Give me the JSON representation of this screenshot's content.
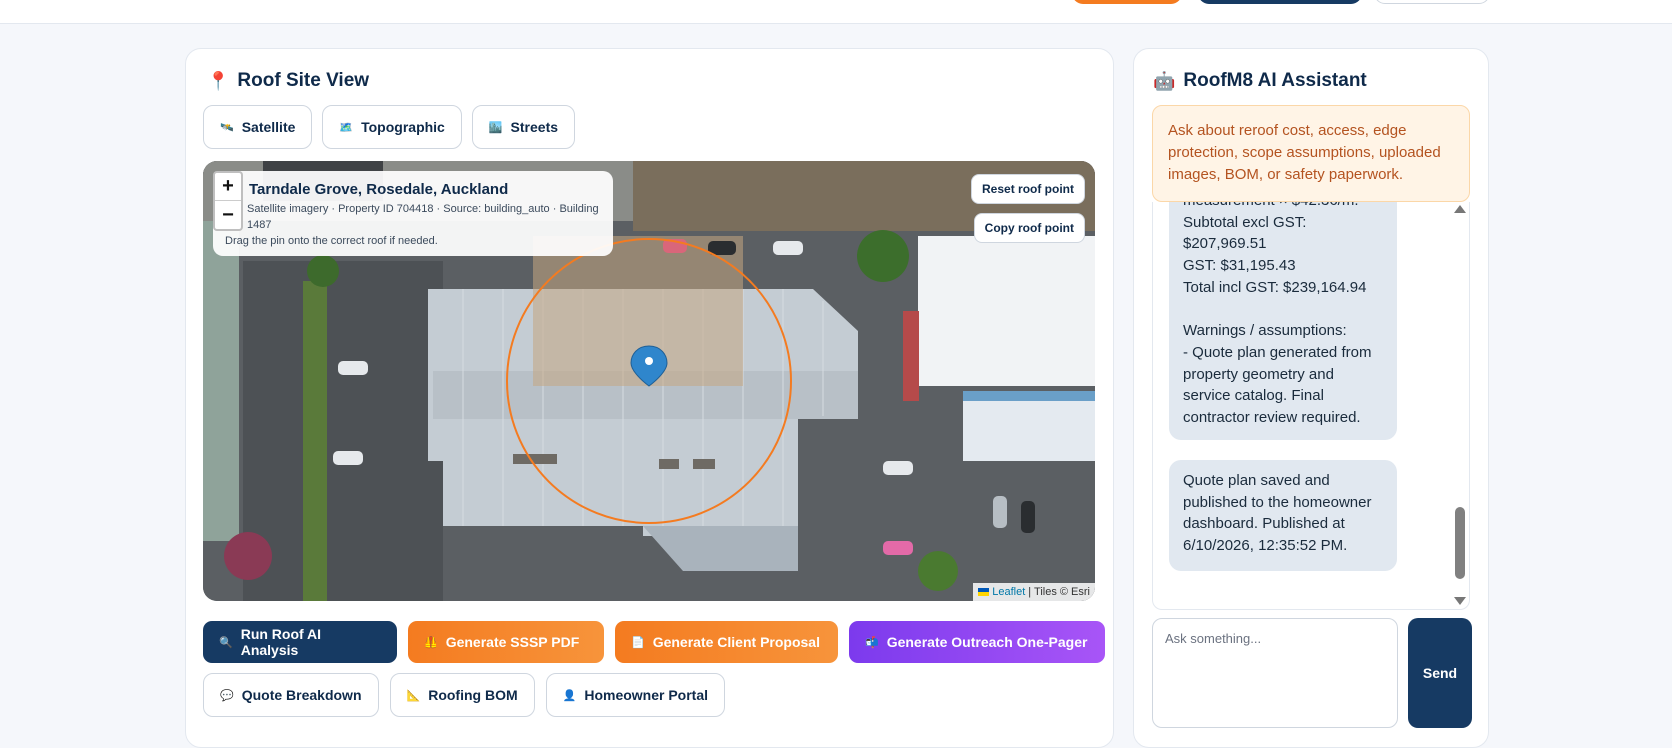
{
  "topbar": {},
  "site_view": {
    "title": "Roof Site View",
    "title_icon": "📍",
    "layer_tabs": [
      {
        "label": "Satellite",
        "icon": "🛰️"
      },
      {
        "label": "Topographic",
        "icon": "🗺️"
      },
      {
        "label": "Streets",
        "icon": "🏙️"
      }
    ],
    "map": {
      "zoom_in": "+",
      "zoom_out": "−",
      "address": "Tarndale Grove, Rosedale, Auckland",
      "meta": "Satellite imagery · Property ID 704418 · Source: building_auto · Building 1487",
      "hint": "Drag the pin onto the correct roof if needed.",
      "reset_button": "Reset roof point",
      "copy_button": "Copy roof point",
      "attribution_link": "Leaflet",
      "attribution_text": "| Tiles © Esri"
    },
    "actions": [
      {
        "label": "Run Roof AI Analysis",
        "icon": "🔍"
      },
      {
        "label": "Generate SSSP PDF",
        "icon": "🦺"
      },
      {
        "label": "Generate Client Proposal",
        "icon": "📄"
      },
      {
        "label": "Generate Outreach One-Pager",
        "icon": "📬"
      }
    ],
    "secondary_actions": [
      {
        "label": "Quote Breakdown",
        "icon": "💬"
      },
      {
        "label": "Roofing BOM",
        "icon": "📐"
      },
      {
        "label": "Homeowner Portal",
        "icon": "👤"
      }
    ]
  },
  "assistant": {
    "title": "RoofM8 AI Assistant",
    "title_icon": "🤖",
    "notice": "Ask about reroof cost, access, edge protection, scope assumptions, uploaded images, BOM, or safety paperwork.",
    "messages": [
      "measurement × $42.36/m.\nSubtotal excl GST: $207,969.51\nGST: $31,195.43\nTotal incl GST: $239,164.94\n\nWarnings / assumptions:\n- Quote plan generated from property geometry and service catalog. Final contractor review required.",
      "Quote plan saved and published to the homeowner dashboard. Published at 6/10/2026, 12:35:52 PM."
    ],
    "input_placeholder": "Ask something...",
    "send_label": "Send"
  },
  "colors": {
    "navy": "#163a63",
    "orange": "#f47b20",
    "purple": "#7c3aed",
    "notice_bg": "#fff4e6"
  }
}
